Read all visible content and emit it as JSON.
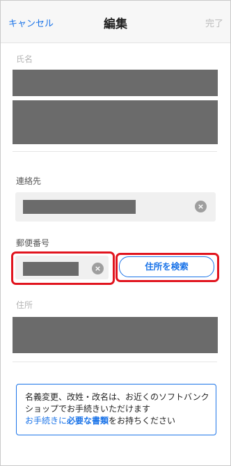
{
  "header": {
    "cancel_label": "キャンセル",
    "title": "編集",
    "done_label": "完了"
  },
  "form": {
    "name_label": "氏名",
    "contact_label": "連絡先",
    "postal_label": "郵便番号",
    "address_search_label": "住所を検索",
    "address_label": "住所",
    "clear_icon": "×"
  },
  "info": {
    "text": "名義変更、改姓・改名は、お近くのソフトバンクショップでお手続きいただけます",
    "link_prefix": "お手続きに",
    "link_bold": "必要な書類",
    "suffix": "をお持ちください"
  },
  "colors": {
    "accent": "#1a73e8",
    "highlight": "#e1141e",
    "redaction": "#6b6b6b"
  }
}
